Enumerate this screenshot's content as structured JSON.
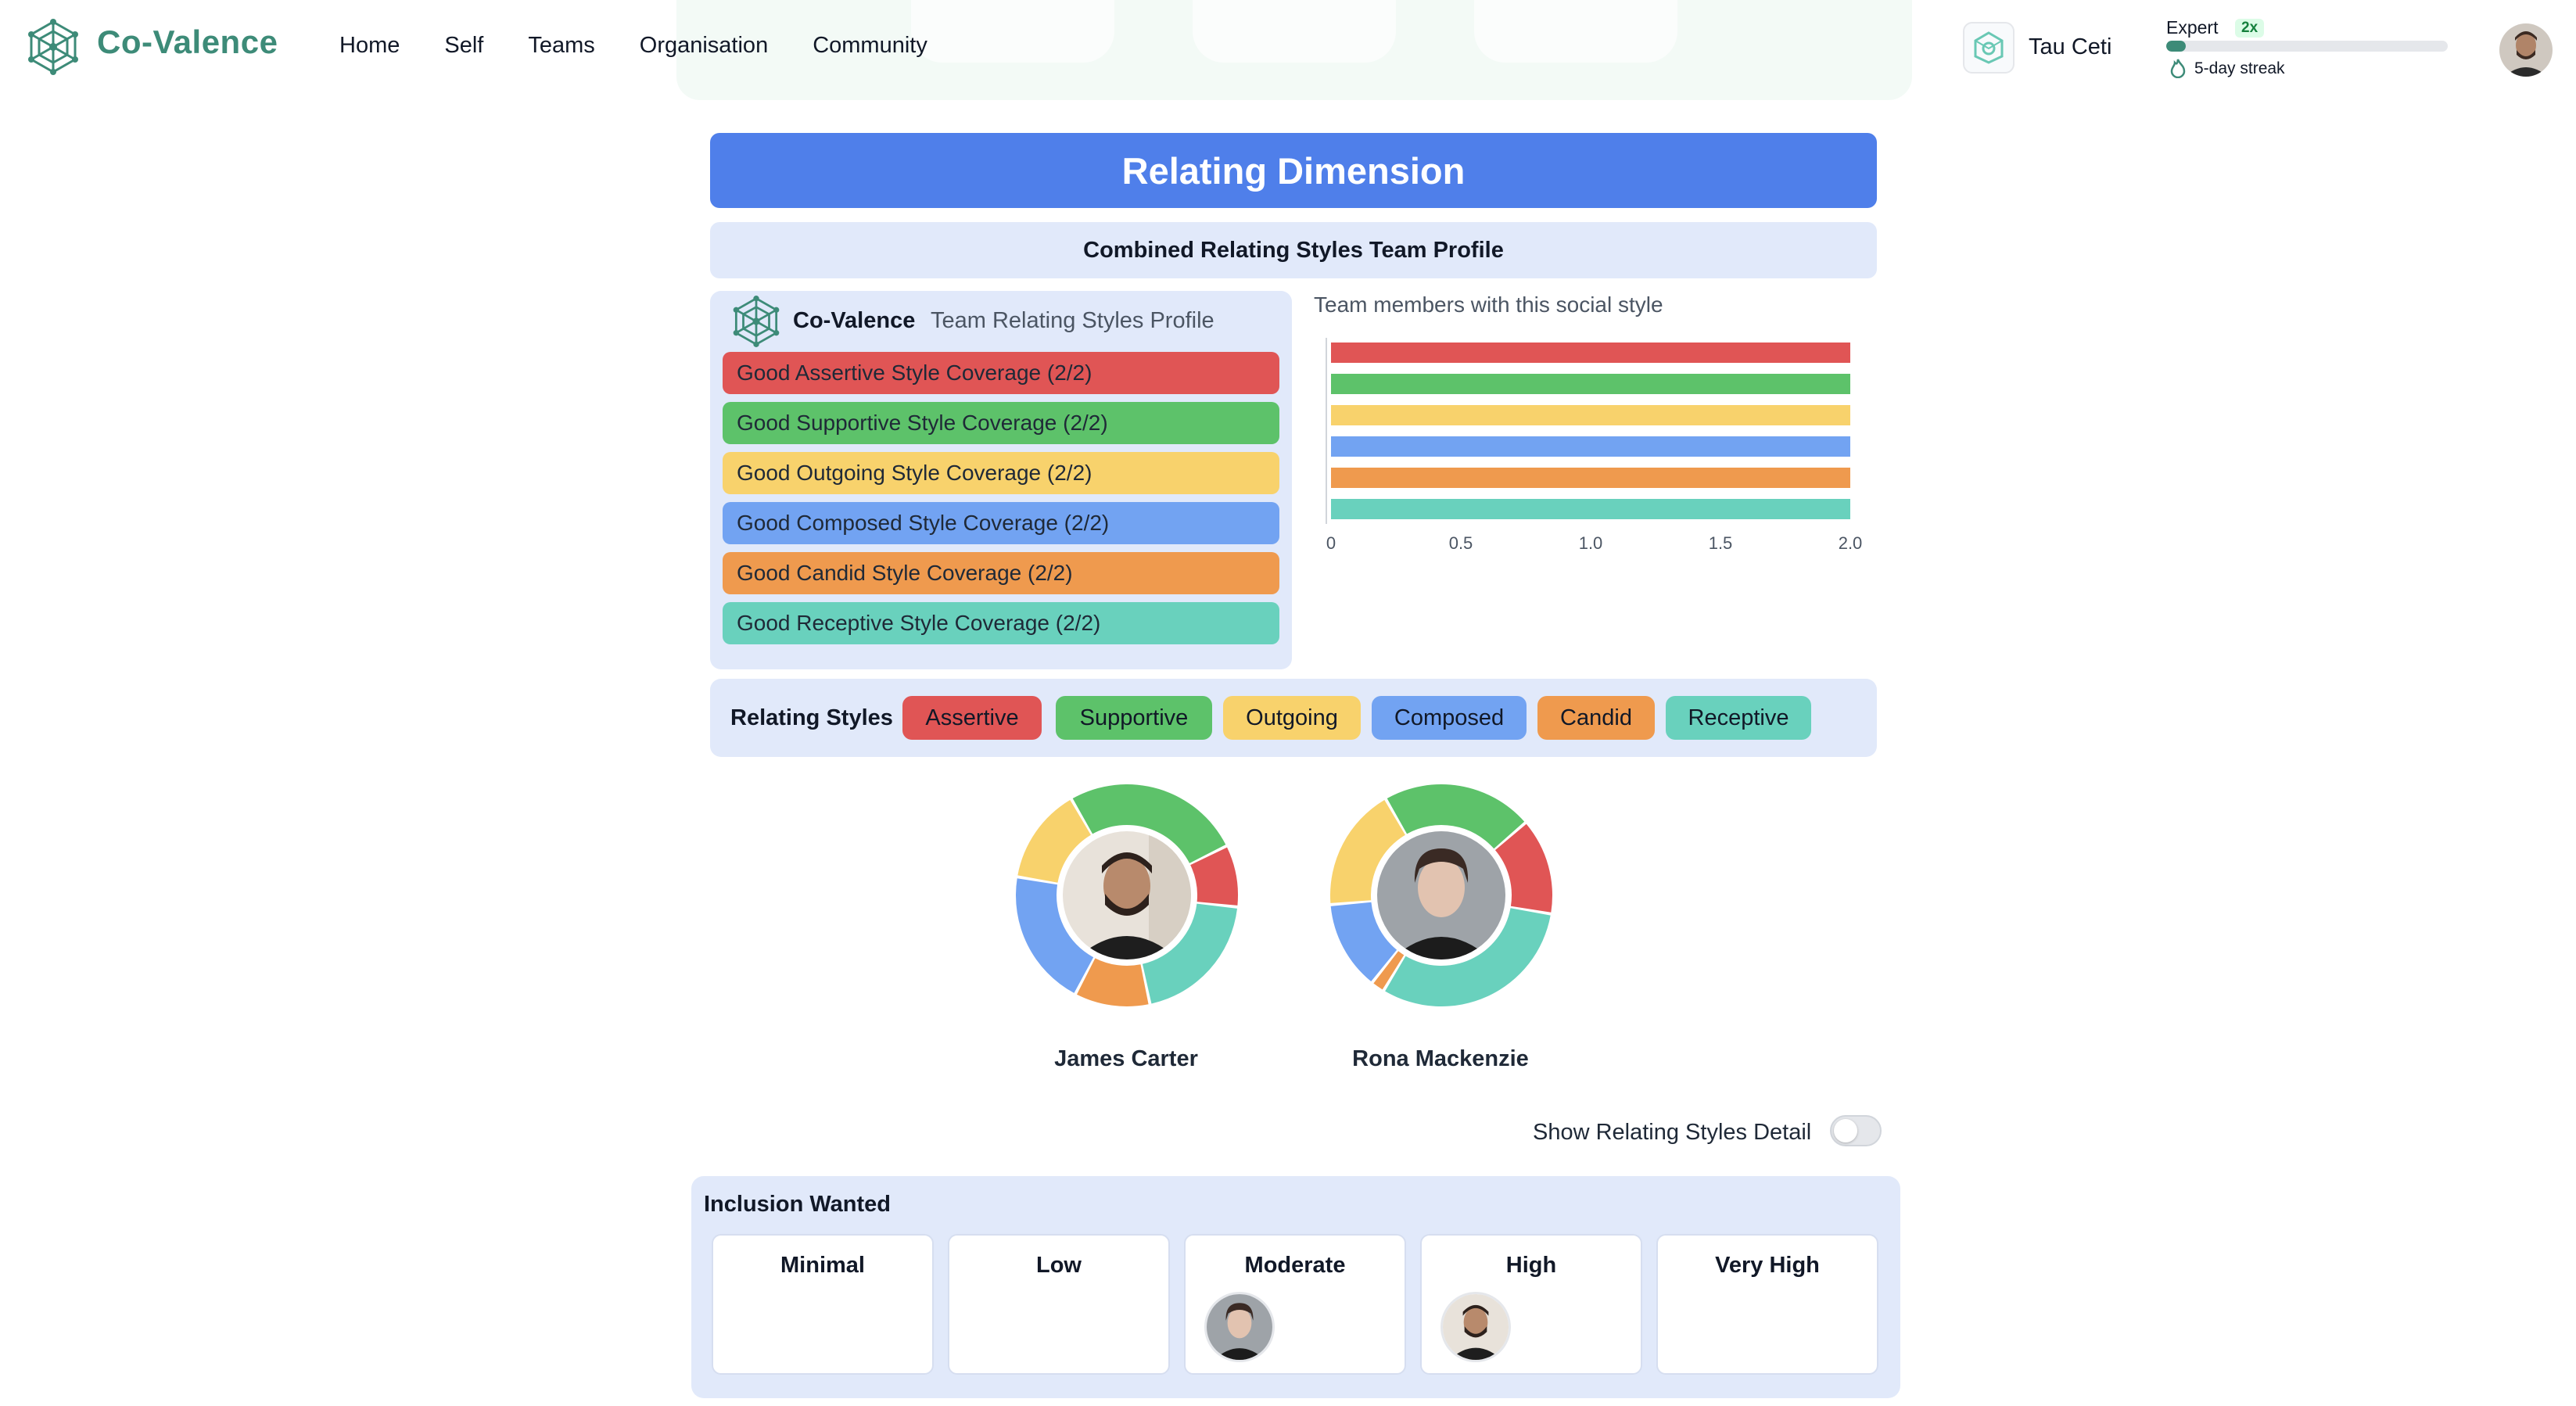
{
  "app": {
    "brand": "Co-Valence"
  },
  "nav": {
    "items": [
      "Home",
      "Self",
      "Teams",
      "Organisation",
      "Community"
    ]
  },
  "team": {
    "name": "Tau Ceti"
  },
  "gamification": {
    "level": "Expert",
    "multiplier": "2x",
    "progress": 0.07,
    "streak": "5-day streak"
  },
  "banner": {
    "title": "Relating Dimension",
    "subtitle": "Combined Relating Styles Team Profile"
  },
  "profile": {
    "brand": "Co-Valence",
    "subtitle": "Team Relating Styles Profile",
    "coverage": [
      {
        "label": "Good Assertive Style Coverage (2/2)",
        "color": "#e05555"
      },
      {
        "label": "Good Supportive Style Coverage (2/2)",
        "color": "#5dc26a"
      },
      {
        "label": "Good Outgoing Style Coverage (2/2)",
        "color": "#f8d26c"
      },
      {
        "label": "Good Composed Style Coverage (2/2)",
        "color": "#72a3f2"
      },
      {
        "label": "Good Candid Style Coverage (2/2)",
        "color": "#ef9a4e"
      },
      {
        "label": "Good Receptive Style Coverage (2/2)",
        "color": "#69d1bd"
      }
    ]
  },
  "chart_data": {
    "type": "bar",
    "orientation": "horizontal",
    "title": "Team members with this social style",
    "categories": [
      "Assertive",
      "Supportive",
      "Outgoing",
      "Composed",
      "Candid",
      "Receptive"
    ],
    "values": [
      2,
      2,
      2,
      2,
      2,
      2
    ],
    "colors": [
      "#e05555",
      "#5dc26a",
      "#f8d26c",
      "#72a3f2",
      "#ef9a4e",
      "#69d1bd"
    ],
    "xlim": [
      0,
      2
    ],
    "xticks": [
      "0",
      "0.5",
      "1.0",
      "1.5",
      "2.0"
    ],
    "grid": false,
    "legend": "none"
  },
  "legend": {
    "title": "Relating Styles",
    "items": [
      {
        "label": "Assertive",
        "color": "#e05555"
      },
      {
        "label": "Supportive",
        "color": "#5dc26a"
      },
      {
        "label": "Outgoing",
        "color": "#f8d26c"
      },
      {
        "label": "Composed",
        "color": "#72a3f2"
      },
      {
        "label": "Candid",
        "color": "#ef9a4e"
      },
      {
        "label": "Receptive",
        "color": "#69d1bd"
      }
    ]
  },
  "people": [
    {
      "name": "James Carter",
      "styles": [
        {
          "style": "Supportive",
          "value": 26,
          "color": "#5dc26a"
        },
        {
          "style": "Assertive",
          "value": 9,
          "color": "#e05555"
        },
        {
          "style": "Receptive",
          "value": 20,
          "color": "#69d1bd"
        },
        {
          "style": "Candid",
          "value": 11,
          "color": "#ef9a4e"
        },
        {
          "style": "Composed",
          "value": 20,
          "color": "#72a3f2"
        },
        {
          "style": "Outgoing",
          "value": 14,
          "color": "#f8d26c"
        }
      ]
    },
    {
      "name": "Rona Mackenzie",
      "styles": [
        {
          "style": "Supportive",
          "value": 22,
          "color": "#5dc26a"
        },
        {
          "style": "Assertive",
          "value": 14,
          "color": "#e05555"
        },
        {
          "style": "Receptive",
          "value": 31,
          "color": "#69d1bd"
        },
        {
          "style": "Candid",
          "value": 2,
          "color": "#ef9a4e"
        },
        {
          "style": "Composed",
          "value": 13,
          "color": "#72a3f2"
        },
        {
          "style": "Outgoing",
          "value": 18,
          "color": "#f8d26c"
        }
      ]
    }
  ],
  "toggle": {
    "label": "Show Relating Styles Detail",
    "on": false
  },
  "inclusion": {
    "title": "Inclusion Wanted",
    "levels": [
      {
        "label": "Minimal",
        "members": []
      },
      {
        "label": "Low",
        "members": []
      },
      {
        "label": "Moderate",
        "members": [
          "Rona Mackenzie"
        ]
      },
      {
        "label": "High",
        "members": [
          "James Carter"
        ]
      },
      {
        "label": "Very High",
        "members": []
      }
    ]
  },
  "icons": {
    "logo": "co-valence-logo-icon",
    "team": "team-badge-icon",
    "streak": "flame-icon",
    "avatar": "user-avatar"
  }
}
